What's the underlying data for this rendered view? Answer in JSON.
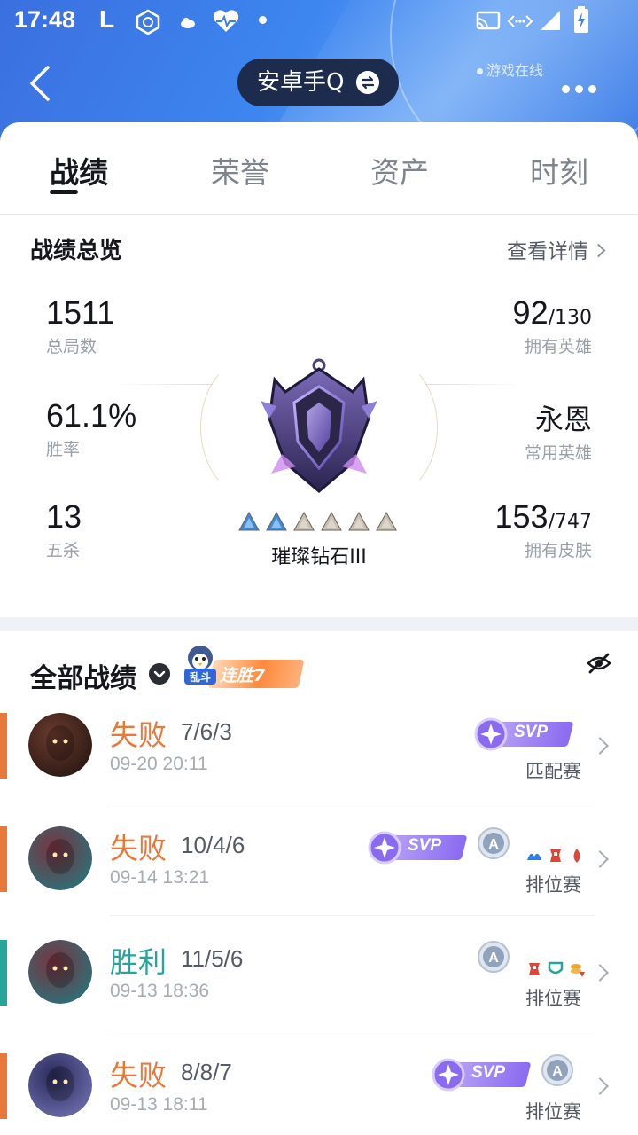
{
  "status_bar": {
    "time": "17:48",
    "left_icons": [
      "L-icon",
      "vpn-icon",
      "cloud-icon",
      "heart-rate-icon",
      "dot-icon"
    ],
    "right_icons": [
      "cast-icon",
      "link-icon",
      "signal-icon",
      "battery-icon"
    ]
  },
  "header": {
    "title": "安卓手Q",
    "online_status": "游戏在线"
  },
  "tabs": [
    {
      "label": "战绩",
      "active": true
    },
    {
      "label": "荣誉",
      "active": false
    },
    {
      "label": "资产",
      "active": false
    },
    {
      "label": "时刻",
      "active": false
    }
  ],
  "overview": {
    "title": "战绩总览",
    "detail_link": "查看详情",
    "total_games": {
      "value": "1511",
      "label": "总局数"
    },
    "win_rate": {
      "value": "61.1%",
      "label": "胜率"
    },
    "penta_kills": {
      "value": "13",
      "label": "五杀"
    },
    "heroes_owned": {
      "value": "92",
      "total": "/130",
      "label": "拥有英雄"
    },
    "common_hero": {
      "value": "永恩",
      "label": "常用英雄"
    },
    "skins_owned": {
      "value": "153",
      "total": "/747",
      "label": "拥有皮肤"
    },
    "rank": {
      "name": "璀璨钻石III",
      "stars_filled": 2,
      "stars_total": 6
    }
  },
  "records": {
    "title": "全部战绩",
    "streak_badge": "连胜7",
    "streak_mascot_text": "乱斗",
    "items": [
      {
        "result": "失败",
        "outcome": "loss",
        "kda": "7/6/3",
        "date": "09-20 20:11",
        "mode": "匹配赛",
        "svp": true,
        "svp_text": "SVP",
        "a_mark": false,
        "mini_icons": []
      },
      {
        "result": "失败",
        "outcome": "loss",
        "kda": "10/4/6",
        "date": "09-14 13:21",
        "mode": "排位赛",
        "svp": true,
        "svp_text": "SVP",
        "a_mark": true,
        "mini_icons": [
          "wave-icon",
          "tower-icon",
          "drop-icon"
        ]
      },
      {
        "result": "胜利",
        "outcome": "win",
        "kda": "11/5/6",
        "date": "09-13 18:36",
        "mode": "排位赛",
        "svp": false,
        "svp_text": "",
        "a_mark": true,
        "mini_icons": [
          "tower-icon",
          "shield-icon",
          "coins-icon"
        ]
      },
      {
        "result": "失败",
        "outcome": "loss",
        "kda": "8/8/7",
        "date": "09-13 18:11",
        "mode": "排位赛",
        "svp": true,
        "svp_text": "SVP",
        "a_mark": true,
        "mini_icons": []
      }
    ]
  },
  "colors": {
    "loss": "#e8793a",
    "win": "#26a69a",
    "header_blue": "#3d7fea",
    "pill_dark": "#1d2c4d"
  }
}
